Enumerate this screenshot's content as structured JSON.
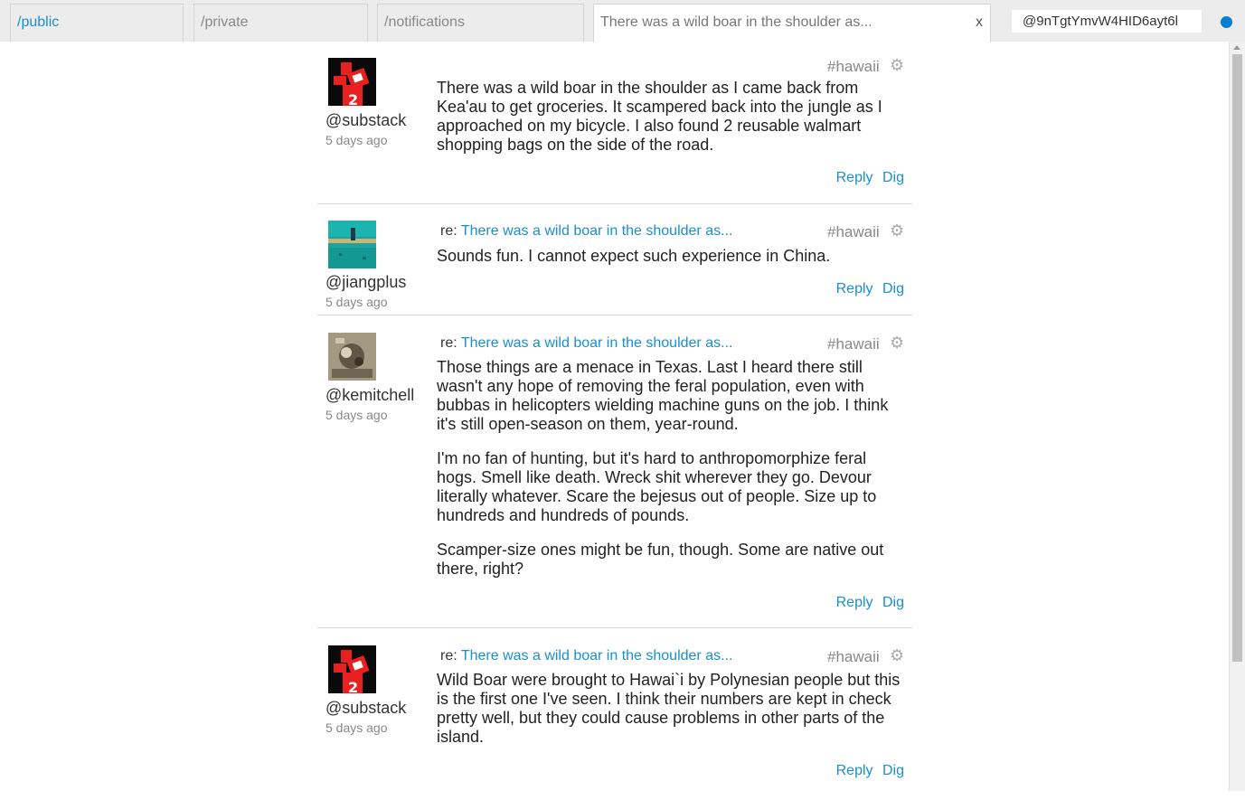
{
  "tabs": {
    "public": "/public",
    "private": "/private",
    "notifications": "/notifications",
    "active": "There was a wild boar in the shoulder as...",
    "close": "x"
  },
  "identity": {
    "value": "@9nTgtYmvW4HID6ayt6l"
  },
  "colors": {
    "link": "#1a8fd0",
    "status_dot": "#0a7fd1"
  },
  "posts": [
    {
      "user": "@substack",
      "time": "5 days ago",
      "tag": "#hawaii",
      "gear_icon": "⚙",
      "paragraphs": [
        "There was a wild boar in the shoulder as I came back from Kea'au to get groceries. It scampered back into the jungle as I approached on my bicycle. I also found 2 reusable walmart shopping bags on the side of the road."
      ],
      "reply": "Reply",
      "dig": "Dig"
    },
    {
      "user": "@jiangplus",
      "time": "5 days ago",
      "tag": "#hawaii",
      "gear_icon": "⚙",
      "re_label": "re:",
      "re_link": "There was a wild boar in the shoulder as...",
      "paragraphs": [
        "Sounds fun. I cannot expect such experience in China."
      ],
      "reply": "Reply",
      "dig": "Dig"
    },
    {
      "user": "@kemitchell",
      "time": "5 days ago",
      "tag": "#hawaii",
      "gear_icon": "⚙",
      "re_label": "re:",
      "re_link": "There was a wild boar in the shoulder as...",
      "paragraphs": [
        "Those things are a menace in Texas. Last I heard there still wasn't any hope of removing the feral population, even with bubbas in helicopters wielding machine guns on the job. I think it's still open-season on them, year-round.",
        "I'm no fan of hunting, but it's hard to anthropomorphize feral hogs. Smell like death. Wreck shit wherever they go. Devour literally whatever. Scare the bejesus out of people. Size up to hundreds and hundreds of pounds.",
        "Scamper-size ones might be fun, though. Some are native out there, right?"
      ],
      "reply": "Reply",
      "dig": "Dig"
    },
    {
      "user": "@substack",
      "time": "5 days ago",
      "tag": "#hawaii",
      "gear_icon": "⚙",
      "re_label": "re:",
      "re_link": "There was a wild boar in the shoulder as...",
      "paragraphs": [
        "Wild Boar were brought to Hawai`i by Polynesian people but this is the first one I've seen. I think their numbers are kept in check pretty well, but they could cause problems in other parts of the island."
      ],
      "reply": "Reply",
      "dig": "Dig"
    }
  ]
}
